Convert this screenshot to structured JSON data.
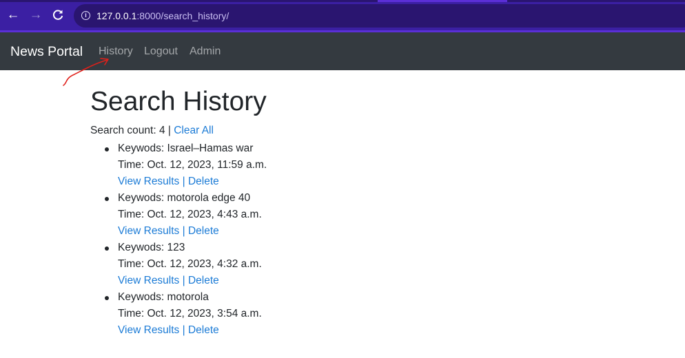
{
  "browser": {
    "url_host": "127.0.0.1",
    "url_path": ":8000/search_history/",
    "back_icon": "arrow-left-icon",
    "forward_icon": "arrow-right-icon",
    "reload_icon": "reload-icon",
    "info_icon": "info-icon",
    "theme_color": "#3b1fa3"
  },
  "navbar": {
    "brand": "News Portal",
    "links": [
      "History",
      "Logout",
      "Admin"
    ],
    "background": "#343a40"
  },
  "main": {
    "title": "Search History",
    "count_label": "Search count: 4",
    "separator": " | ",
    "clear_all": "Clear All",
    "link_color": "#1b7bd6",
    "items": [
      {
        "keywords": "Keywods: Israel–Hamas war",
        "time": "Time: Oct. 12, 2023, 11:59 a.m.",
        "view": "View Results",
        "sep": " | ",
        "delete": "Delete"
      },
      {
        "keywords": "Keywods: motorola edge 40",
        "time": "Time: Oct. 12, 2023, 4:43 a.m.",
        "view": "View Results",
        "sep": " | ",
        "delete": "Delete"
      },
      {
        "keywords": "Keywods: 123",
        "time": "Time: Oct. 12, 2023, 4:32 a.m.",
        "view": "View Results",
        "sep": " | ",
        "delete": "Delete"
      },
      {
        "keywords": "Keywods: motorola",
        "time": "Time: Oct. 12, 2023, 3:54 a.m.",
        "view": "View Results",
        "sep": " | ",
        "delete": "Delete"
      }
    ]
  },
  "annotation": {
    "color": "#e0201a"
  }
}
